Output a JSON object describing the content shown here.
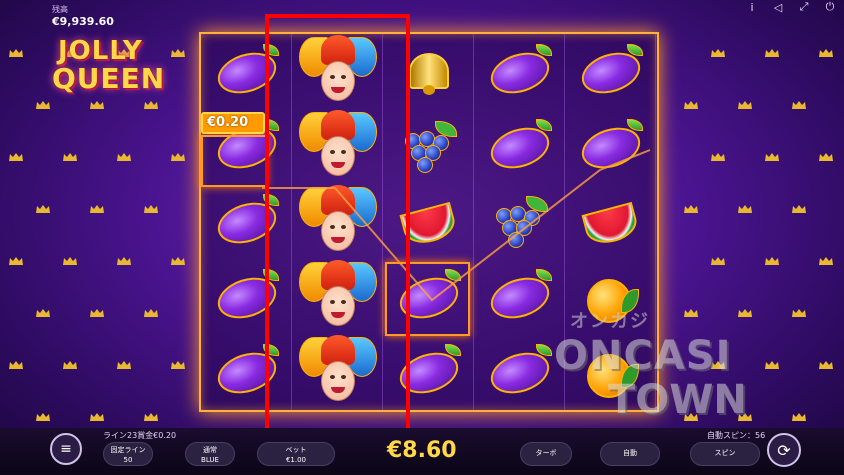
{
  "header": {
    "balance_label": "残高",
    "balance_value": "€9,939.60",
    "icons": [
      "info-icon",
      "volume-icon",
      "fullscreen-icon",
      "power-icon"
    ]
  },
  "logo": {
    "line1": "JOLLY",
    "line2": "QUEEN"
  },
  "reels": [
    [
      "plum",
      "plum",
      "plum",
      "plum",
      "plum"
    ],
    [
      "jester",
      "jester",
      "jester",
      "jester",
      "jester"
    ],
    [
      "bell",
      "grapes",
      "watermelon",
      "plum",
      "plum"
    ],
    [
      "plum",
      "plum",
      "grapes",
      "plum",
      "plum"
    ],
    [
      "plum",
      "plum",
      "watermelon",
      "orange",
      "orange"
    ]
  ],
  "win": {
    "badge": "€0.20"
  },
  "footer": {
    "line_win_text": "ライン23賞金€0.20",
    "fixed_lines_label": "固定ライン",
    "fixed_lines_value": "50",
    "speed_label": "通常",
    "speed_value": "BLUE",
    "bet_label": "ベット",
    "bet_value": "€1.00",
    "total_amount": "€8.60",
    "auto_spin_text": "自動スピン：56",
    "turbo_label": "ターボ",
    "auto_label": "自動",
    "spin_label": "スピン"
  },
  "watermark": {
    "line1": "オンカジ",
    "line2": "ONCASI",
    "line3": "TOWN"
  },
  "colors": {
    "frame": "#ffb23a",
    "highlight": "#ff0000",
    "amount": "#ffd84a"
  }
}
